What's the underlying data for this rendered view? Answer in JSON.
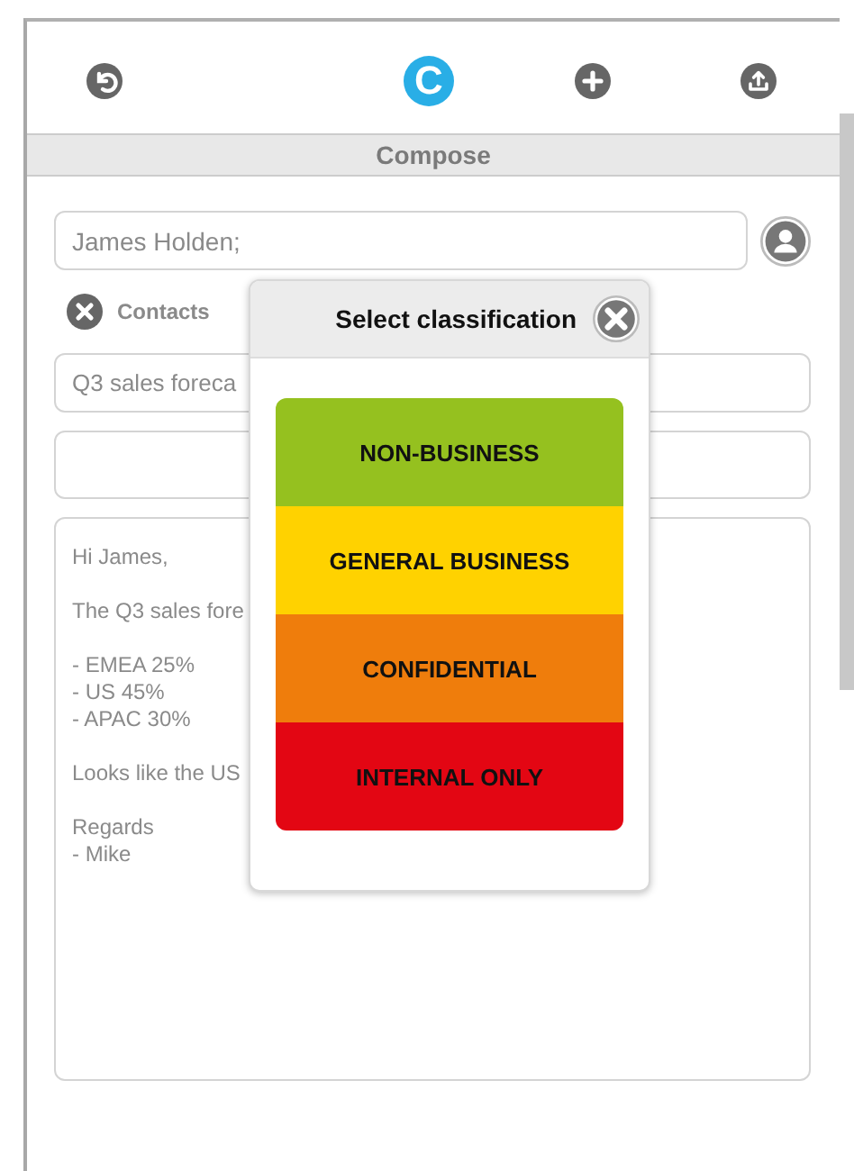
{
  "toolbar": {
    "logo": "C"
  },
  "header": {
    "title": "Compose"
  },
  "to_field": {
    "value": "James Holden;"
  },
  "contacts": {
    "label": "Contacts"
  },
  "subject_field": {
    "value": "Q3 sales foreca"
  },
  "body": {
    "paragraphs": [
      [
        "Hi James,"
      ],
      [
        "The Q3 sales fore"
      ],
      [
        "- EMEA 25%",
        "- US 45%",
        "- APAC 30%"
      ],
      [
        "Looks like the US"
      ],
      [
        "Regards",
        "- Mike"
      ]
    ]
  },
  "dialog": {
    "title": "Select classification",
    "options": [
      {
        "label": "NON-BUSINESS",
        "color": "#95c11f"
      },
      {
        "label": "GENERAL BUSINESS",
        "color": "#ffd200"
      },
      {
        "label": "CONFIDENTIAL",
        "color": "#ef7d0c"
      },
      {
        "label": "INTERNAL ONLY",
        "color": "#e30613"
      }
    ]
  }
}
